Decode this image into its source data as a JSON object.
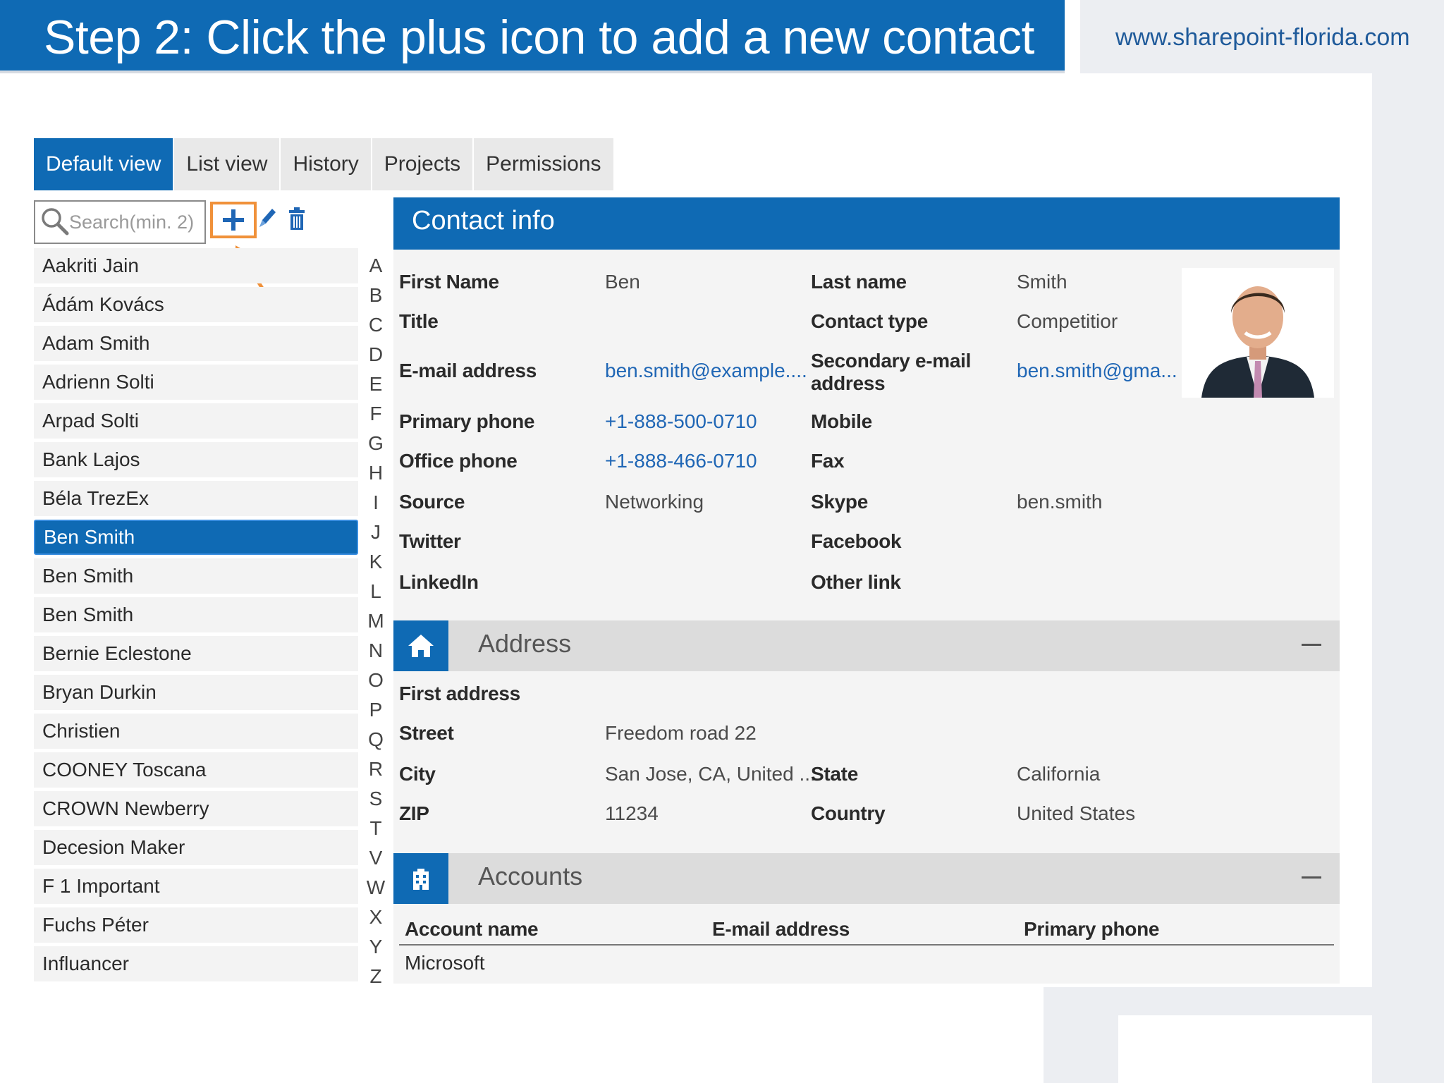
{
  "slide": {
    "title": "Step 2: Click the plus icon to add a new contact",
    "url": "www.sharepoint-florida.com"
  },
  "tabs": [
    {
      "label": "Default view",
      "active": true
    },
    {
      "label": "List view",
      "active": false
    },
    {
      "label": "History",
      "active": false
    },
    {
      "label": "Projects",
      "active": false
    },
    {
      "label": "Permissions",
      "active": false
    }
  ],
  "toolbar": {
    "search_placeholder": "Search(min. 2)",
    "add_icon": "plus-icon",
    "edit_icon": "pencil-icon",
    "delete_icon": "trash-icon",
    "highlight_color": "#f0913a"
  },
  "contacts": [
    {
      "name": "Aakriti Jain",
      "selected": false
    },
    {
      "name": "Ádám Kovács",
      "selected": false
    },
    {
      "name": "Adam Smith",
      "selected": false
    },
    {
      "name": "Adrienn Solti",
      "selected": false
    },
    {
      "name": "Arpad Solti",
      "selected": false
    },
    {
      "name": "Bank Lajos",
      "selected": false
    },
    {
      "name": "Béla TrezEx",
      "selected": false
    },
    {
      "name": "Ben Smith",
      "selected": true
    },
    {
      "name": "Ben Smith",
      "selected": false
    },
    {
      "name": "Ben Smith",
      "selected": false
    },
    {
      "name": "Bernie Eclestone",
      "selected": false
    },
    {
      "name": "Bryan Durkin",
      "selected": false
    },
    {
      "name": "Christien",
      "selected": false
    },
    {
      "name": "COONEY Toscana",
      "selected": false
    },
    {
      "name": "CROWN Newberry",
      "selected": false
    },
    {
      "name": "Decesion Maker",
      "selected": false
    },
    {
      "name": "F 1 Important",
      "selected": false
    },
    {
      "name": "Fuchs Péter",
      "selected": false
    },
    {
      "name": "Influancer",
      "selected": false
    }
  ],
  "alphabet": [
    "A",
    "B",
    "C",
    "D",
    "E",
    "F",
    "G",
    "H",
    "I",
    "J",
    "K",
    "L",
    "M",
    "N",
    "O",
    "P",
    "Q",
    "R",
    "S",
    "T",
    "V",
    "W",
    "X",
    "Y",
    "Z"
  ],
  "contact_info": {
    "header": "Contact info",
    "first_name_label": "First Name",
    "first_name": "Ben",
    "last_name_label": "Last name",
    "last_name": "Smith",
    "title_label": "Title",
    "title": "",
    "contact_type_label": "Contact type",
    "contact_type": "Competitior",
    "email_label": "E-mail address",
    "email": "ben.smith@example....",
    "secondary_email_label_1": "Secondary e-mail",
    "secondary_email_label_2": "address",
    "secondary_email": "ben.smith@gma...",
    "primary_phone_label": "Primary phone",
    "primary_phone": "+1-888-500-0710",
    "mobile_label": "Mobile",
    "mobile": "",
    "office_phone_label": "Office phone",
    "office_phone": "+1-888-466-0710",
    "fax_label": "Fax",
    "fax": "",
    "source_label": "Source",
    "source": "Networking",
    "skype_label": "Skype",
    "skype": "ben.smith",
    "twitter_label": "Twitter",
    "facebook_label": "Facebook",
    "linkedin_label": "LinkedIn",
    "other_link_label": "Other link"
  },
  "address": {
    "section_title": "Address",
    "icon": "home-icon",
    "first_address_label": "First address",
    "street_label": "Street",
    "street": "Freedom road 22",
    "city_label": "City",
    "city": "San Jose, CA, United ...",
    "state_label": "State",
    "state": "California",
    "zip_label": "ZIP",
    "zip": "11234",
    "country_label": "Country",
    "country": "United States"
  },
  "accounts": {
    "section_title": "Accounts",
    "icon": "building-icon",
    "columns": [
      "Account name",
      "E-mail address",
      "Primary phone"
    ],
    "rows": [
      [
        "Microsoft",
        "",
        ""
      ]
    ]
  }
}
